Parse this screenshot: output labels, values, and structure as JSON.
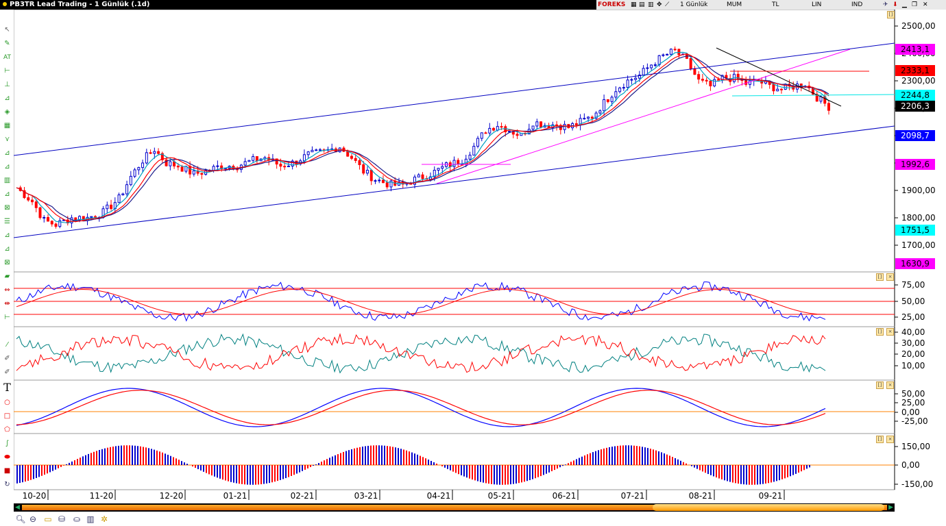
{
  "window": {
    "title": "PB3TR Lead Trading - 1 Günlük (.1d)",
    "toolbar": {
      "brand": "FOREKS",
      "period": "1 Günlük",
      "chart_type": "MUM",
      "currency": "TL",
      "scale": "LIN",
      "indicator_menu": "IND"
    }
  },
  "price_axis": {
    "ticks": [
      "2500,00",
      "2400,00",
      "2300,00",
      "2200,00",
      "2100,00",
      "2000,00",
      "1900,00",
      "1800,00",
      "1700,00"
    ],
    "badges": [
      {
        "value": "2413,1",
        "bg": "#ff00ff",
        "fg": "#000000"
      },
      {
        "value": "2333,1",
        "bg": "#ff0000",
        "fg": "#000000"
      },
      {
        "value": "2244,8",
        "bg": "#00ffff",
        "fg": "#000000"
      },
      {
        "value": "2206,3",
        "bg": "#000000",
        "fg": "#ffffff"
      },
      {
        "value": "2098,7",
        "bg": "#0000ff",
        "fg": "#ffffff"
      },
      {
        "value": "1992,6",
        "bg": "#ff00ff",
        "fg": "#000000"
      },
      {
        "value": "1751,5",
        "bg": "#00ffff",
        "fg": "#000000"
      },
      {
        "value": "1630,9",
        "bg": "#ff00ff",
        "fg": "#000000"
      }
    ]
  },
  "rsi_axis": {
    "ticks": [
      "75,00",
      "50,00",
      "25,00"
    ]
  },
  "dmi_axis": {
    "ticks": [
      "40,00",
      "30,00",
      "20,00",
      "10,00"
    ]
  },
  "macd_axis": {
    "ticks": [
      "50,00",
      "25,00",
      "0,00",
      "-25,00"
    ]
  },
  "hist_axis": {
    "ticks": [
      "150,00",
      "0,00",
      "-150,00"
    ]
  },
  "time_axis": {
    "labels": [
      "10-20",
      "11-20",
      "12-20",
      "01-21",
      "02-21",
      "03-21",
      "04-21",
      "05-21",
      "06-21",
      "07-21",
      "08-21",
      "09-21"
    ]
  },
  "colors": {
    "up": "#0000cc",
    "down": "#ff0000",
    "ma_fast": "#00a0c0",
    "ma_mid": "#1a1a8a",
    "ma_slow": "#ff0000",
    "channel": "#0000c0",
    "trend": "#ff00ff",
    "rsi": "#0000ff",
    "rsi_sig": "#ff0000",
    "dmi_a": "#008080",
    "dmi_b": "#ff0000",
    "macd": "#0000ff",
    "macd_sig": "#ff0000",
    "zero": "#ff8000"
  },
  "icons": [
    "pointer-icon",
    "pencil-icon",
    "text-at-icon",
    "horizontal-line-icon",
    "vertical-line-icon",
    "fan-icon",
    "fibonacci-icon",
    "grid-icon",
    "text-icon",
    "ellipse-icon",
    "rectangle-icon",
    "polygon-icon",
    "wave-icon",
    "fill-ellipse-icon",
    "fill-rect-icon",
    "redo-icon"
  ],
  "bottom_icons": [
    "zoom-icon",
    "zoom-out-icon",
    "folder-icon",
    "database-icon",
    "cylinder-icon",
    "settings-icon"
  ]
}
